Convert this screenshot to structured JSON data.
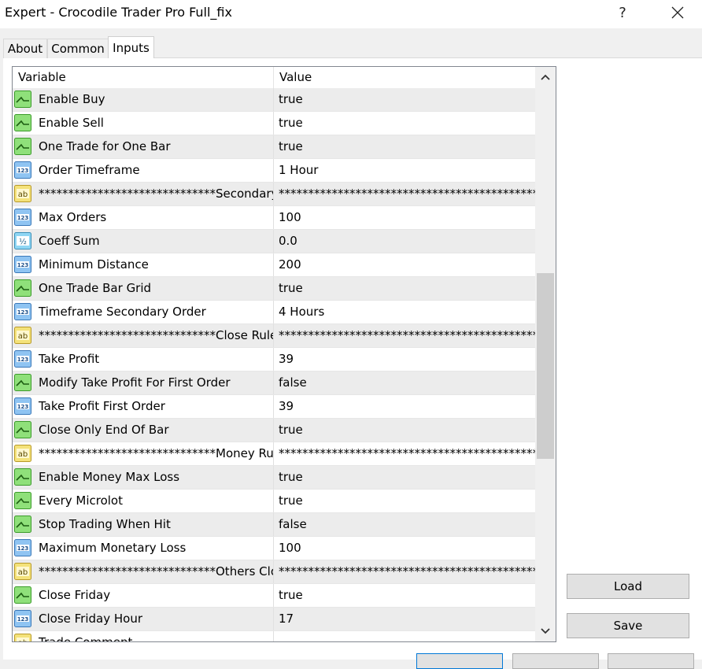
{
  "window": {
    "title": "Expert - Crocodile Trader Pro Full_fix",
    "help_label": "?"
  },
  "tabs": [
    {
      "label": "About",
      "active": false
    },
    {
      "label": "Common",
      "active": false
    },
    {
      "label": "Inputs",
      "active": true
    }
  ],
  "table": {
    "columns": [
      "Variable",
      "Value"
    ],
    "rows": [
      {
        "type": "bool",
        "variable": "Enable Buy",
        "value": "true"
      },
      {
        "type": "bool",
        "variable": "Enable Sell",
        "value": "true"
      },
      {
        "type": "bool",
        "variable": "One Trade for One Bar",
        "value": "true"
      },
      {
        "type": "int",
        "variable": "Order Timeframe",
        "value": "1 Hour"
      },
      {
        "type": "string",
        "variable": "******************************Secondary En...",
        "value": "*************************************************..."
      },
      {
        "type": "int",
        "variable": "Max Orders",
        "value": "100"
      },
      {
        "type": "double",
        "variable": "Coeff Sum",
        "value": "0.0"
      },
      {
        "type": "int",
        "variable": "Minimum Distance",
        "value": "200"
      },
      {
        "type": "bool",
        "variable": "One Trade Bar Grid",
        "value": "true"
      },
      {
        "type": "int",
        "variable": "Timeframe Secondary Order",
        "value": "4 Hours"
      },
      {
        "type": "string",
        "variable": "******************************Close Rules**...",
        "value": "*************************************************..."
      },
      {
        "type": "int",
        "variable": "Take Profit",
        "value": "39"
      },
      {
        "type": "bool",
        "variable": "Modify Take Profit For First Order",
        "value": "false"
      },
      {
        "type": "int",
        "variable": "Take Profit First Order",
        "value": "39"
      },
      {
        "type": "bool",
        "variable": "Close Only End Of Bar",
        "value": "true"
      },
      {
        "type": "string",
        "variable": "******************************Money Rules*...",
        "value": "*************************************************..."
      },
      {
        "type": "bool",
        "variable": "Enable Money Max Loss",
        "value": "true"
      },
      {
        "type": "bool",
        "variable": "Every Microlot",
        "value": "true"
      },
      {
        "type": "bool",
        "variable": "Stop Trading When Hit",
        "value": "false"
      },
      {
        "type": "int",
        "variable": "Maximum Monetary Loss",
        "value": "100"
      },
      {
        "type": "string",
        "variable": "******************************Others Close ...",
        "value": "*************************************************..."
      },
      {
        "type": "bool",
        "variable": "Close Friday",
        "value": "true"
      },
      {
        "type": "int",
        "variable": "Close Friday Hour",
        "value": "17"
      },
      {
        "type": "string",
        "variable": "Trade Comment",
        "value": ""
      }
    ]
  },
  "buttons": {
    "load": "Load",
    "save": "Save"
  },
  "icons": {
    "bool": "bool-param-icon",
    "int": "int-param-icon",
    "double": "double-param-icon",
    "string": "string-param-icon"
  }
}
